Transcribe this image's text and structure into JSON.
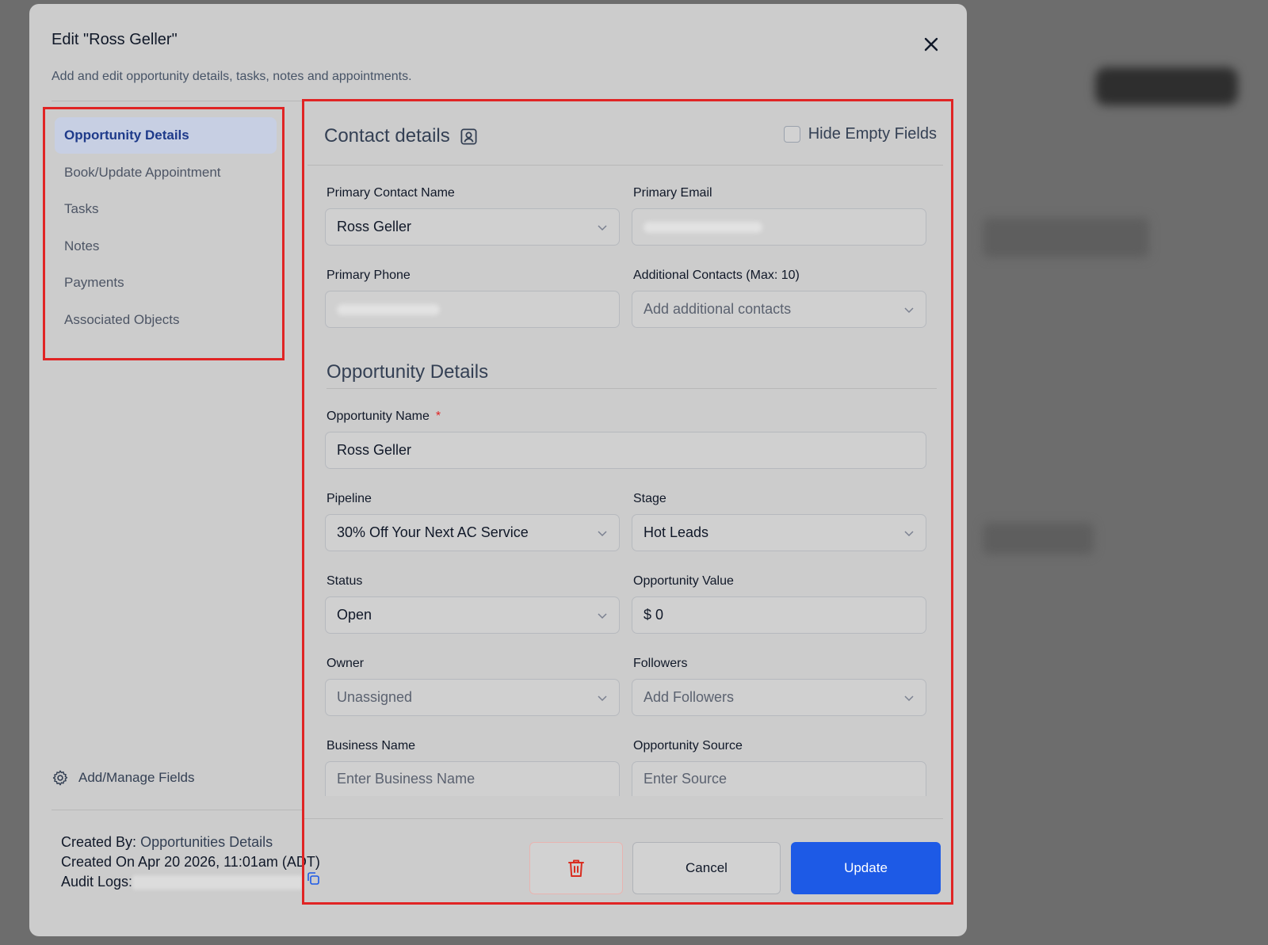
{
  "modal": {
    "title": "Edit \"Ross Geller\"",
    "subtitle": "Add and edit opportunity details, tasks, notes and appointments."
  },
  "sidebar": {
    "items": [
      {
        "label": "Opportunity Details",
        "active": true
      },
      {
        "label": "Book/Update Appointment",
        "active": false
      },
      {
        "label": "Tasks",
        "active": false
      },
      {
        "label": "Notes",
        "active": false
      },
      {
        "label": "Payments",
        "active": false
      },
      {
        "label": "Associated Objects",
        "active": false
      }
    ],
    "manage_fields_label": "Add/Manage Fields",
    "created_by_label": "Created By:",
    "created_by_value": "Opportunities Details",
    "created_on": "Created On Apr 20 2026, 11:01am (ADT)",
    "audit_logs_label": "Audit Logs:"
  },
  "contact": {
    "title": "Contact details",
    "hide_empty_label": "Hide Empty Fields",
    "primary_contact_label": "Primary Contact Name",
    "primary_contact_value": "Ross Geller",
    "primary_email_label": "Primary Email",
    "primary_phone_label": "Primary Phone",
    "additional_contacts_label": "Additional Contacts (Max: 10)",
    "additional_contacts_placeholder": "Add additional contacts"
  },
  "opportunity": {
    "title": "Opportunity Details",
    "name_label": "Opportunity Name",
    "required_mark": "*",
    "name_value": "Ross Geller",
    "pipeline_label": "Pipeline",
    "pipeline_value": "30% Off Your Next AC Service",
    "stage_label": "Stage",
    "stage_value": "Hot Leads",
    "status_label": "Status",
    "status_value": "Open",
    "value_label": "Opportunity Value",
    "value_value": "$ 0",
    "owner_label": "Owner",
    "owner_value": "Unassigned",
    "followers_label": "Followers",
    "followers_placeholder": "Add Followers",
    "business_label": "Business Name",
    "business_placeholder": "Enter Business Name",
    "source_label": "Opportunity Source",
    "source_placeholder": "Enter Source"
  },
  "footer": {
    "cancel_label": "Cancel",
    "update_label": "Update"
  },
  "colors": {
    "highlight_border": "#e02424",
    "primary_button": "#1d5ae6",
    "active_nav_text": "#1e3a8a"
  }
}
